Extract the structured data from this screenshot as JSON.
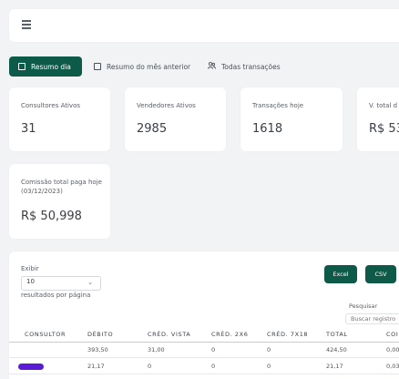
{
  "tabs": [
    {
      "label": "Resumo dia",
      "active": true
    },
    {
      "label": "Resumo do mês anterior",
      "active": false
    },
    {
      "label": "Todas transações",
      "active": false
    }
  ],
  "stats": [
    {
      "label": "Consultores Ativos",
      "value": "31"
    },
    {
      "label": "Vendedores Ativos",
      "value": "2985"
    },
    {
      "label": "Transações hoje",
      "value": "1618"
    },
    {
      "label": "V. total d",
      "value": "R$ 53"
    }
  ],
  "commission": {
    "label": "Comissão total paga hoje (03/12/2023)",
    "value": "R$ 50,998"
  },
  "table_controls": {
    "show_label": "Exibir",
    "page_size": "10",
    "per_page_label": "resultados por página",
    "excel_label": "Excel",
    "csv_label": "CSV",
    "search_label": "Pesquisar",
    "search_placeholder": "Buscar registro"
  },
  "table": {
    "columns": [
      "CONSULTOR",
      "DÉBITO",
      "CRÉD. VISTA",
      "CRÉD. 2X6",
      "CRÉD. 7X18",
      "TOTAL",
      "COI"
    ],
    "rows": [
      [
        "",
        "393,50",
        "31,00",
        "0",
        "0",
        "424,50",
        "0,00"
      ],
      [
        "",
        "21,17",
        "0",
        "0",
        "0",
        "21,17",
        "0,03"
      ]
    ]
  },
  "colors": {
    "accent": "#0e5a48",
    "redaction": "#5b1ad6"
  },
  "icons": [
    "menu-icon",
    "calendar-icon",
    "calendar-icon",
    "users-icon",
    "chevron-down-icon"
  ]
}
